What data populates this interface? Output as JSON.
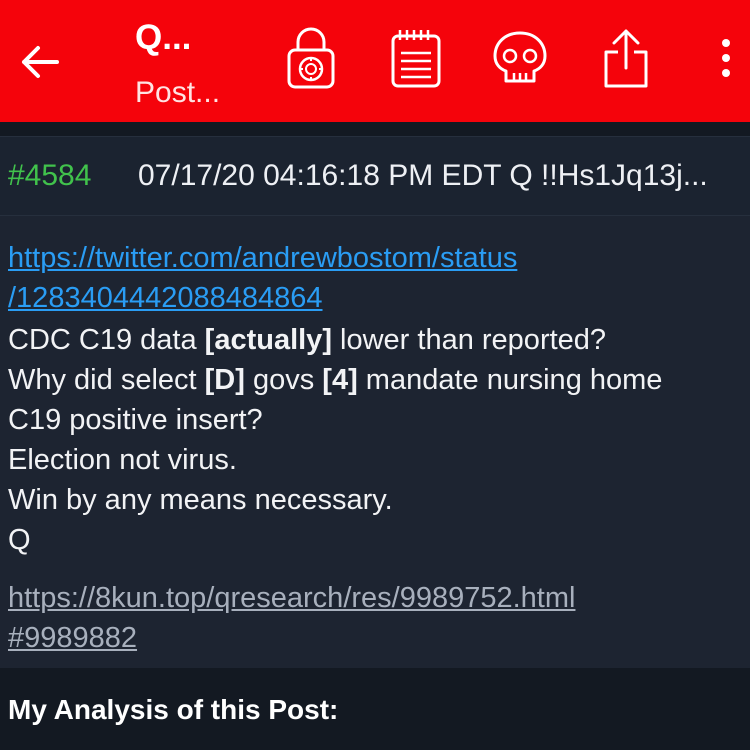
{
  "toolbar": {
    "title": "Q...",
    "subtitle": "Post...",
    "icons": [
      "back-arrow-icon",
      "padlock-icon",
      "notepad-icon",
      "skull-icon",
      "share-icon",
      "more-vert-icon"
    ],
    "background_color": "#f5030b"
  },
  "post": {
    "number": "#4584",
    "meta": "07/17/20 04:16:18 PM EDT Q !!Hs1Jq13j...",
    "twitter_link_line1": "https://twitter.com/andrewbostom/status",
    "twitter_link_line2": "/1283404442088484864",
    "lines": [
      {
        "pre": "CDC C19 data ",
        "bold": "[actually]",
        "post": " lower than reported?"
      },
      {
        "pre": "Why did select ",
        "bold": "[D]",
        "mid": " govs ",
        "bold2": "[4]",
        "post": " mandate nursing home"
      },
      {
        "text": "C19 positive insert?"
      },
      {
        "text": "Election not virus."
      },
      {
        "text": "Win by any means necessary."
      },
      {
        "text": "Q"
      }
    ],
    "source_link_line1": "https://8kun.top/qresearch/res/9989752.html",
    "source_link_line2": "#9989882"
  },
  "analysis": {
    "heading": "My Analysis of this Post:"
  },
  "colors": {
    "post_number": "#41c24c",
    "link": "#2a9df4",
    "source_link": "#a8b0bd"
  }
}
